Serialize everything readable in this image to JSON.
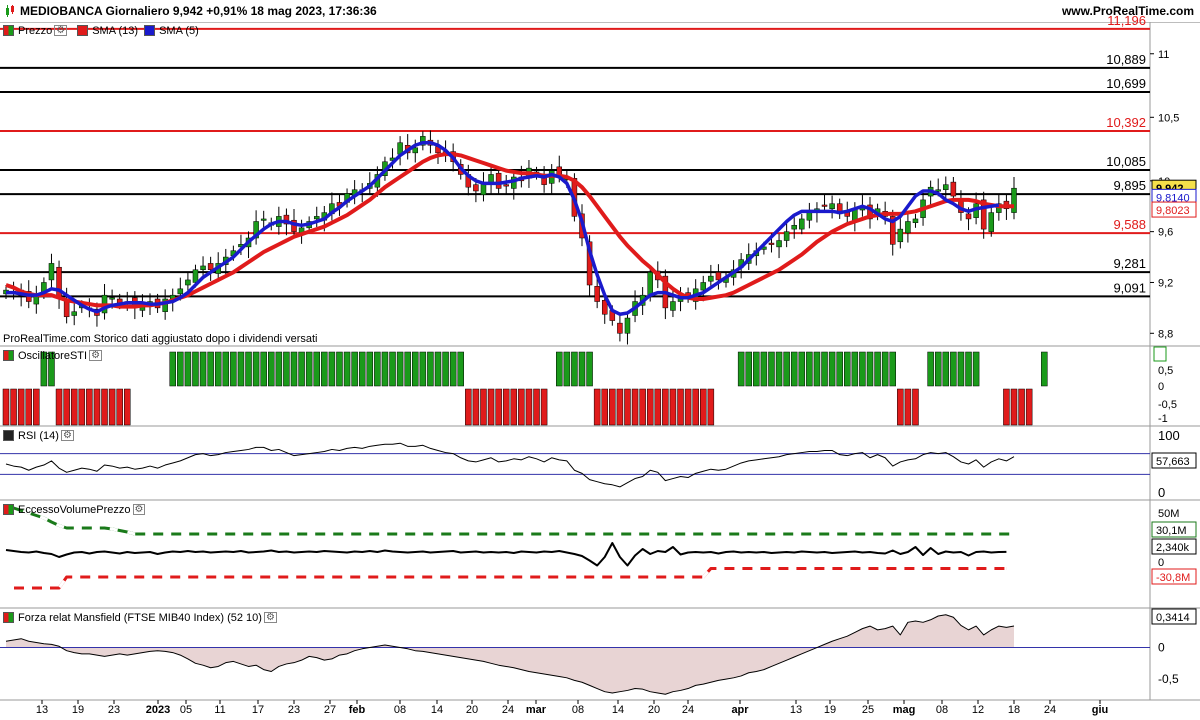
{
  "header": {
    "title": "MEDIOBANCA Giornaliero 9,942 +0,91% 18 mag 2023, 17:36:36",
    "site": "www.ProRealTime.com"
  },
  "note": "ProRealTime.com Storico dati aggiustato dopo i dividendi versati",
  "legends": {
    "price": [
      "Prezzo",
      "SMA (13)",
      "SMA (5)"
    ],
    "sti": "OscillatoreSTI",
    "rsi": "RSI (14)",
    "volume": "EccessoVolumePrezzo",
    "mansfield": "Forza relat Mansfield (FTSE MIB40 Index) (52 10)"
  },
  "colors": {
    "up": "#1a9a1a",
    "down": "#e01b1b",
    "sma13": "#e01b1b",
    "sma5": "#1a1acc",
    "support": "#e01b1b",
    "level": "#000000"
  },
  "axes": {
    "price_ticks": [
      "11",
      "10,5",
      "10",
      "9,6",
      "9,2",
      "8,8"
    ],
    "sti_ticks": [
      "1",
      "0,5",
      "0",
      "-0,5",
      "-1"
    ],
    "rsi_ticks": [
      "100",
      "0"
    ],
    "volume_ticks": [
      "50M",
      "0"
    ],
    "mansfield_ticks": [
      "0",
      "-0,5"
    ],
    "x_ticks": [
      "13",
      "19",
      "23",
      "2023",
      "05",
      "11",
      "17",
      "23",
      "27",
      "feb",
      "08",
      "14",
      "20",
      "24",
      "mar",
      "08",
      "14",
      "20",
      "24",
      "apr",
      "13",
      "19",
      "25",
      "mag",
      "08",
      "12",
      "18",
      "24",
      "giu"
    ]
  },
  "value_labels": {
    "last_price": "9,942",
    "sma5_value": "9,8140",
    "sma13_value": "9,8023",
    "rsi_value": "57,663",
    "vol_upper": "30,1M",
    "vol_value": "2,340k",
    "vol_lower": "-30,8M",
    "mansfield_value": "0,3414"
  },
  "chart_data": {
    "type": "candlestick",
    "horizontal_levels": [
      {
        "value": 11.196,
        "label": "11,196",
        "color": "red"
      },
      {
        "value": 10.889,
        "label": "10,889",
        "color": "black"
      },
      {
        "value": 10.699,
        "label": "10,699",
        "color": "black"
      },
      {
        "value": 10.392,
        "label": "10,392",
        "color": "red"
      },
      {
        "value": 10.085,
        "label": "10,085",
        "color": "black"
      },
      {
        "value": 9.895,
        "label": "9,895",
        "color": "black"
      },
      {
        "value": 9.588,
        "label": "9,588",
        "color": "red"
      },
      {
        "value": 9.281,
        "label": "9,281",
        "color": "black"
      },
      {
        "value": 9.091,
        "label": "9,091",
        "color": "black"
      }
    ],
    "price_range": [
      8.7,
      11.25
    ],
    "closes": [
      9.14,
      9.13,
      9.1,
      9.05,
      9.11,
      9.2,
      9.35,
      9.08,
      8.93,
      8.97,
      9.02,
      8.99,
      8.94,
      9.1,
      9.08,
      9.03,
      9.05,
      9.0,
      9.02,
      9.05,
      9.0,
      9.07,
      9.1,
      9.15,
      9.22,
      9.3,
      9.33,
      9.3,
      9.35,
      9.4,
      9.45,
      9.5,
      9.55,
      9.68,
      9.7,
      9.65,
      9.72,
      9.66,
      9.6,
      9.63,
      9.68,
      9.72,
      9.75,
      9.82,
      9.8,
      9.9,
      9.93,
      9.92,
      9.98,
      10.05,
      10.15,
      10.18,
      10.3,
      10.22,
      10.26,
      10.35,
      10.28,
      10.22,
      10.2,
      10.15,
      10.05,
      9.95,
      9.92,
      9.98,
      10.05,
      9.94,
      9.96,
      10.03,
      10.0,
      10.1,
      10.05,
      9.97,
      10.08,
      10.04,
      10.02,
      9.72,
      9.55,
      9.18,
      9.05,
      8.95,
      8.9,
      8.8,
      8.92,
      9.05,
      9.1,
      9.28,
      9.22,
      9.0,
      9.05,
      9.1,
      9.08,
      9.15,
      9.2,
      9.25,
      9.22,
      9.24,
      9.3,
      9.38,
      9.42,
      9.45,
      9.48,
      9.5,
      9.53,
      9.6,
      9.65,
      9.7,
      9.75,
      9.78,
      9.8,
      9.82,
      9.74,
      9.72,
      9.78,
      9.8,
      9.7,
      9.78,
      9.72,
      9.5,
      9.62,
      9.68,
      9.7,
      9.85,
      9.95,
      9.93,
      9.97,
      9.88,
      9.75,
      9.7,
      9.82,
      9.62,
      9.75,
      9.82,
      9.78,
      9.942
    ],
    "sma13": [
      9.18,
      9.16,
      9.13,
      9.11,
      9.1,
      9.1,
      9.1,
      9.08,
      9.06,
      9.05,
      9.04,
      9.03,
      9.02,
      9.02,
      9.02,
      9.01,
      9.01,
      9.01,
      9.02,
      9.02,
      9.03,
      9.04,
      9.06,
      9.08,
      9.1,
      9.13,
      9.16,
      9.19,
      9.22,
      9.25,
      9.28,
      9.32,
      9.36,
      9.4,
      9.44,
      9.47,
      9.5,
      9.53,
      9.56,
      9.58,
      9.6,
      9.62,
      9.64,
      9.67,
      9.7,
      9.73,
      9.77,
      9.81,
      9.85,
      9.9,
      9.95,
      9.99,
      10.03,
      10.07,
      10.11,
      10.15,
      10.18,
      10.2,
      10.21,
      10.21,
      10.2,
      10.18,
      10.16,
      10.14,
      10.12,
      10.1,
      10.08,
      10.07,
      10.06,
      10.06,
      10.05,
      10.04,
      10.04,
      10.04,
      10.03,
      10.0,
      9.95,
      9.88,
      9.8,
      9.72,
      9.64,
      9.56,
      9.49,
      9.43,
      9.37,
      9.32,
      9.26,
      9.2,
      9.15,
      9.11,
      9.08,
      9.07,
      9.07,
      9.08,
      9.09,
      9.1,
      9.12,
      9.15,
      9.18,
      9.21,
      9.24,
      9.27,
      9.3,
      9.34,
      9.38,
      9.42,
      9.47,
      9.52,
      9.56,
      9.6,
      9.63,
      9.66,
      9.68,
      9.7,
      9.72,
      9.73,
      9.74,
      9.74,
      9.74,
      9.75,
      9.76,
      9.78,
      9.8,
      9.82,
      9.84,
      9.85,
      9.85,
      9.85,
      9.84,
      9.82,
      9.81,
      9.8,
      9.8,
      9.8
    ],
    "sma5": [
      9.12,
      9.12,
      9.11,
      9.1,
      9.1,
      9.12,
      9.15,
      9.14,
      9.1,
      9.06,
      9.02,
      8.99,
      8.97,
      9.0,
      9.02,
      9.03,
      9.04,
      9.04,
      9.04,
      9.03,
      9.03,
      9.04,
      9.05,
      9.08,
      9.12,
      9.18,
      9.24,
      9.28,
      9.32,
      9.36,
      9.4,
      9.46,
      9.52,
      9.57,
      9.62,
      9.66,
      9.68,
      9.68,
      9.66,
      9.65,
      9.66,
      9.68,
      9.7,
      9.75,
      9.79,
      9.84,
      9.88,
      9.92,
      9.96,
      10.02,
      10.08,
      10.14,
      10.2,
      10.24,
      10.28,
      10.3,
      10.3,
      10.28,
      10.24,
      10.18,
      10.1,
      10.04,
      10.0,
      9.98,
      9.98,
      9.98,
      9.99,
      10.0,
      10.02,
      10.03,
      10.04,
      10.03,
      10.05,
      10.03,
      9.98,
      9.85,
      9.68,
      9.45,
      9.26,
      9.1,
      8.98,
      8.95,
      8.96,
      9.0,
      9.05,
      9.1,
      9.12,
      9.12,
      9.1,
      9.08,
      9.08,
      9.1,
      9.12,
      9.16,
      9.2,
      9.24,
      9.28,
      9.32,
      9.38,
      9.44,
      9.5,
      9.56,
      9.62,
      9.68,
      9.73,
      9.76,
      9.76,
      9.76,
      9.76,
      9.76,
      9.75,
      9.76,
      9.78,
      9.8,
      9.78,
      9.74,
      9.7,
      9.68,
      9.72,
      9.8,
      9.88,
      9.92,
      9.92,
      9.9,
      9.85,
      9.82,
      9.78,
      9.76,
      9.78,
      9.79,
      9.8,
      9.81
    ],
    "sti_signal": [
      -1,
      -1,
      -1,
      -1,
      -1,
      1,
      1,
      -1,
      -1,
      -1,
      -1,
      -1,
      -1,
      -1,
      -1,
      -1,
      -1,
      0,
      0,
      0,
      0,
      0,
      1,
      1,
      1,
      1,
      1,
      1,
      1,
      1,
      1,
      1,
      1,
      1,
      1,
      1,
      1,
      1,
      1,
      1,
      1,
      1,
      1,
      1,
      1,
      1,
      1,
      1,
      1,
      1,
      1,
      1,
      1,
      1,
      1,
      1,
      1,
      1,
      1,
      1,
      1,
      -1,
      -1,
      -1,
      -1,
      -1,
      -1,
      -1,
      -1,
      -1,
      -1,
      -1,
      0,
      1,
      1,
      1,
      1,
      1,
      -1,
      -1,
      -1,
      -1,
      -1,
      -1,
      -1,
      -1,
      -1,
      -1,
      -1,
      -1,
      -1,
      -1,
      -1,
      -1,
      0,
      0,
      0,
      1,
      1,
      1,
      1,
      1,
      1,
      1,
      1,
      1,
      1,
      1,
      1,
      1,
      1,
      1,
      1,
      1,
      1,
      1,
      1,
      1,
      -1,
      -1,
      -1,
      0,
      1,
      1,
      1,
      1,
      1,
      1,
      1,
      0,
      0,
      0,
      -1,
      -1,
      -1,
      -1,
      0,
      1
    ],
    "rsi": [
      50,
      46,
      44,
      38,
      44,
      48,
      56,
      42,
      34,
      38,
      42,
      40,
      36,
      48,
      46,
      42,
      44,
      40,
      42,
      46,
      42,
      48,
      52,
      56,
      62,
      68,
      70,
      66,
      68,
      72,
      74,
      76,
      78,
      82,
      82,
      76,
      78,
      72,
      66,
      68,
      70,
      72,
      74,
      78,
      76,
      80,
      82,
      80,
      84,
      86,
      88,
      88,
      90,
      84,
      84,
      86,
      80,
      76,
      72,
      70,
      62,
      56,
      54,
      58,
      62,
      54,
      56,
      60,
      58,
      64,
      60,
      54,
      62,
      58,
      56,
      38,
      32,
      20,
      16,
      12,
      10,
      6,
      14,
      22,
      26,
      38,
      34,
      18,
      22,
      26,
      24,
      32,
      36,
      40,
      38,
      40,
      46,
      52,
      56,
      58,
      60,
      62,
      64,
      68,
      70,
      72,
      74,
      74,
      76,
      76,
      68,
      66,
      70,
      72,
      62,
      68,
      62,
      46,
      54,
      58,
      60,
      68,
      72,
      70,
      72,
      64,
      54,
      50,
      58,
      44,
      54,
      60,
      56,
      64
    ],
    "rsi_levels": [
      70,
      30
    ],
    "volume_excess": [
      6,
      4,
      2,
      1,
      3,
      0,
      -2,
      -8,
      -3,
      1,
      2,
      -1,
      2,
      3,
      1,
      -1,
      2,
      0,
      1,
      2,
      -2,
      1,
      3,
      2,
      4,
      2,
      3,
      1,
      2,
      3,
      2,
      4,
      1,
      2,
      3,
      5,
      2,
      3,
      1,
      2,
      3,
      2,
      4,
      3,
      2,
      1,
      3,
      2,
      4,
      2,
      5,
      3,
      2,
      1,
      2,
      3,
      1,
      2,
      3,
      4,
      1,
      2,
      3,
      1,
      2,
      1,
      2,
      0,
      3,
      2,
      1,
      3,
      2,
      4,
      1,
      -2,
      -6,
      -15,
      -25,
      -8,
      20,
      -8,
      -25,
      -5,
      8,
      -2,
      4,
      2,
      12,
      -3,
      1,
      2,
      1,
      2,
      -1,
      2,
      3,
      1,
      2,
      1,
      2,
      0,
      1,
      2,
      1,
      3,
      2,
      1,
      2,
      0,
      1,
      2,
      3,
      1,
      2,
      0,
      -1,
      5,
      -2,
      2,
      12,
      -4,
      10,
      -2,
      3,
      1,
      2,
      -5,
      2,
      3,
      1,
      2,
      2.3
    ],
    "volume_upper_band": [
      95,
      90,
      85,
      80,
      75,
      70,
      62,
      55,
      50,
      50,
      50,
      50,
      50,
      50,
      48,
      45,
      42,
      38,
      38,
      38,
      38,
      38,
      38,
      38,
      38,
      38,
      38,
      38,
      38,
      38,
      38,
      38,
      38,
      38,
      38,
      38,
      38,
      38,
      38,
      38,
      38,
      38,
      38,
      38,
      38,
      38,
      38,
      38,
      38,
      38,
      38,
      38,
      38,
      38,
      38,
      38,
      38,
      38,
      38,
      38,
      38,
      38,
      38,
      38,
      38,
      38,
      38,
      38,
      38,
      38,
      38,
      38,
      38,
      38,
      38,
      38,
      38,
      38,
      38,
      38,
      38,
      38,
      38,
      38,
      38,
      38,
      38,
      38,
      38,
      38,
      38,
      38,
      38,
      38,
      38,
      38,
      38,
      38,
      38,
      38,
      38,
      38,
      38,
      38,
      38,
      38,
      38,
      38,
      38,
      38,
      38,
      38,
      38,
      38,
      38,
      38,
      38,
      38,
      38,
      38,
      38,
      38,
      38,
      38,
      38,
      38,
      38,
      38,
      38,
      38,
      38,
      38,
      38,
      38
    ],
    "volume_lower_band": [
      -70,
      -70,
      -70,
      -70,
      -70,
      -70,
      -70,
      -70,
      -48,
      -48,
      -48,
      -48,
      -48,
      -48,
      -48,
      -48,
      -48,
      -48,
      -48,
      -48,
      -48,
      -48,
      -48,
      -48,
      -48,
      -48,
      -48,
      -48,
      -48,
      -48,
      -48,
      -48,
      -48,
      -48,
      -48,
      -48,
      -48,
      -48,
      -48,
      -48,
      -48,
      -48,
      -48,
      -48,
      -48,
      -48,
      -48,
      -48,
      -48,
      -48,
      -48,
      -48,
      -48,
      -48,
      -48,
      -48,
      -48,
      -48,
      -48,
      -48,
      -48,
      -48,
      -48,
      -48,
      -48,
      -48,
      -48,
      -48,
      -48,
      -48,
      -48,
      -48,
      -48,
      -48,
      -48,
      -48,
      -48,
      -48,
      -48,
      -48,
      -48,
      -48,
      -48,
      -48,
      -48,
      -48,
      -48,
      -48,
      -48,
      -48,
      -48,
      -48,
      -48,
      -31,
      -31,
      -31,
      -31,
      -31,
      -31,
      -31,
      -31,
      -31,
      -31,
      -31,
      -31,
      -31,
      -31,
      -31,
      -31,
      -31,
      -31,
      -31,
      -31,
      -31,
      -31,
      -31,
      -31,
      -31,
      -31,
      -31,
      -31,
      -31,
      -31,
      -31,
      -31,
      -31,
      -31,
      -31,
      -31,
      -31,
      -31,
      -31,
      -31
    ],
    "mansfield": [
      0.1,
      0.12,
      0.14,
      0.1,
      0.08,
      0.06,
      0.05,
      0.02,
      -0.05,
      -0.08,
      -0.1,
      -0.1,
      -0.12,
      -0.14,
      -0.12,
      -0.1,
      -0.12,
      -0.1,
      -0.08,
      -0.06,
      -0.05,
      -0.06,
      -0.08,
      -0.12,
      -0.18,
      -0.25,
      -0.28,
      -0.32,
      -0.3,
      -0.24,
      -0.22,
      -0.26,
      -0.3,
      -0.28,
      -0.35,
      -0.38,
      -0.3,
      -0.26,
      -0.24,
      -0.2,
      -0.14,
      -0.16,
      -0.2,
      -0.18,
      -0.12,
      -0.1,
      -0.05,
      -0.02,
      0.0,
      0.02,
      0.04,
      0.02,
      0.0,
      -0.02,
      -0.05,
      -0.06,
      -0.08,
      -0.1,
      -0.12,
      -0.14,
      -0.16,
      -0.18,
      -0.2,
      -0.22,
      -0.25,
      -0.28,
      -0.3,
      -0.32,
      -0.35,
      -0.38,
      -0.4,
      -0.42,
      -0.44,
      -0.46,
      -0.48,
      -0.52,
      -0.55,
      -0.6,
      -0.65,
      -0.7,
      -0.72,
      -0.7,
      -0.68,
      -0.65,
      -0.66,
      -0.7,
      -0.72,
      -0.74,
      -0.7,
      -0.68,
      -0.65,
      -0.6,
      -0.58,
      -0.55,
      -0.52,
      -0.5,
      -0.48,
      -0.45,
      -0.4,
      -0.38,
      -0.35,
      -0.3,
      -0.25,
      -0.2,
      -0.15,
      -0.1,
      -0.05,
      0.0,
      0.05,
      0.1,
      0.14,
      0.18,
      0.24,
      0.3,
      0.34,
      0.28,
      0.3,
      0.34,
      0.2,
      0.4,
      0.42,
      0.4,
      0.44,
      0.5,
      0.52,
      0.48,
      0.35,
      0.28,
      0.34,
      0.2,
      0.28,
      0.34,
      0.32,
      0.3414
    ],
    "mansfield_range": [
      -0.8,
      0.5
    ]
  }
}
